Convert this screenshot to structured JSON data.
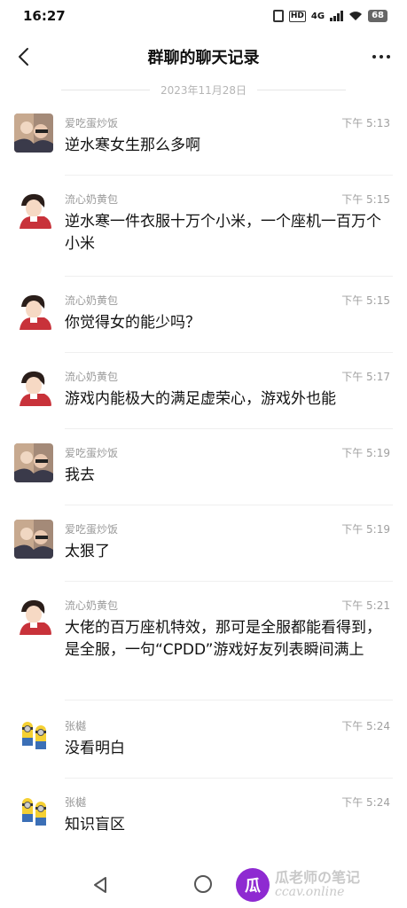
{
  "status_bar": {
    "time": "16:27",
    "network": "4G",
    "battery": "68"
  },
  "header": {
    "title": "群聊的聊天记录"
  },
  "date_separator": "2023年11月28日",
  "messages": [
    {
      "sender": "爱吃蛋炒饭",
      "time": "下午 5:13",
      "text": "逆水寒女生那么多啊",
      "avatar": "photo-avatar"
    },
    {
      "sender": "流心奶黄包",
      "time": "下午 5:15",
      "text": "逆水寒一件衣服十万个小米，一个座机一百万个小米",
      "avatar": "anime-avatar"
    },
    {
      "sender": "流心奶黄包",
      "time": "下午 5:15",
      "text": "你觉得女的能少吗？",
      "avatar": "anime-avatar"
    },
    {
      "sender": "流心奶黄包",
      "time": "下午 5:17",
      "text": "游戏内能极大的满足虚荣心，游戏外也能",
      "avatar": "anime-avatar"
    },
    {
      "sender": "爱吃蛋炒饭",
      "time": "下午 5:19",
      "text": "我去",
      "avatar": "photo-avatar"
    },
    {
      "sender": "爱吃蛋炒饭",
      "time": "下午 5:19",
      "text": "太狠了",
      "avatar": "photo-avatar"
    },
    {
      "sender": "流心奶黄包",
      "time": "下午 5:21",
      "text": "大佬的百万座机特效，那可是全服都能看得到，是全服，一句“CPDD”游戏好友列表瞬间满上",
      "avatar": "anime-avatar"
    },
    {
      "sender": "张樾",
      "time": "下午 5:24",
      "text": "没看明白",
      "avatar": "minion-avatar"
    },
    {
      "sender": "张樾",
      "time": "下午 5:24",
      "text": "知识盲区",
      "avatar": "minion-avatar"
    }
  ],
  "watermark": {
    "logo": "瓜",
    "line1": "瓜老师の笔记",
    "line2": "ccav.online"
  }
}
